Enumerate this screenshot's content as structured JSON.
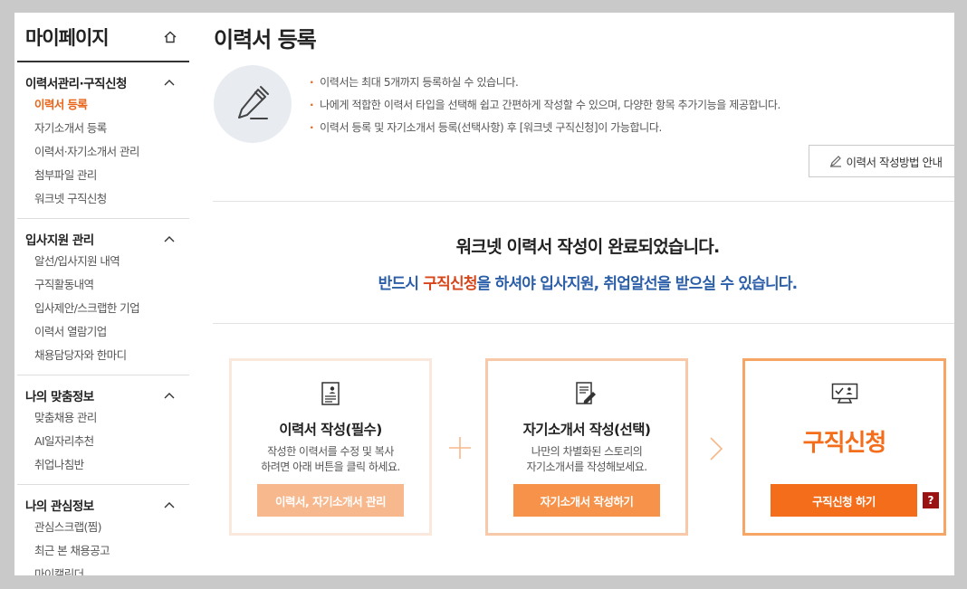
{
  "sidebar": {
    "title": "마이페이지",
    "groups": [
      {
        "label": "이력서관리·구직신청",
        "items": [
          "이력서 등록",
          "자기소개서 등록",
          "이력서·자기소개서 관리",
          "첨부파일 관리",
          "워크넷 구직신청"
        ]
      },
      {
        "label": "입사지원 관리",
        "items": [
          "알선/입사지원 내역",
          "구직활동내역",
          "입사제안/스크랩한 기업",
          "이력서 열람기업",
          "채용담당자와 한마디"
        ]
      },
      {
        "label": "나의 맞춤정보",
        "items": [
          "맞춤채용 관리",
          "AI일자리추천",
          "취업나침반"
        ]
      },
      {
        "label": "나의 관심정보",
        "items": [
          "관심스크랩(찜)",
          "최근 본 채용공고",
          "마이캘린더"
        ]
      }
    ]
  },
  "main": {
    "title": "이력서 등록",
    "notes": [
      "이력서는 최대 5개까지 등록하실 수 있습니다.",
      "나에게 적합한 이력서 타입을 선택해 쉽고 간편하게 작성할 수 있으며, 다양한 항목 추가기능을 제공합니다.",
      "이력서 등록 및 자기소개서 등록(선택사항) 후 [워크넷 구직신청]이 가능합니다."
    ],
    "guide_button": "이력서 작성방법 안내",
    "complete_message": "워크넷 이력서 작성이 완료되었습니다.",
    "notice": {
      "before": "반드시 ",
      "highlight": "구직신청",
      "after": "을 하셔야 입사지원, 취업알선을 받으실 수 있습니다."
    },
    "steps": [
      {
        "title": "이력서 작성(필수)",
        "desc_line1": "작성한 이력서를 수정 및 복사",
        "desc_line2": "하려면 아래 버튼을 클릭 하세요.",
        "button": "이력서, 자기소개서 관리"
      },
      {
        "title": "자기소개서 작성(선택)",
        "desc_line1": "나만의 차별화된 스토리의",
        "desc_line2": "자기소개서를 작성해보세요.",
        "button": "자기소개서 작성하기"
      },
      {
        "title": "구직신청",
        "button": "구직신청 하기",
        "help": "?"
      }
    ]
  },
  "colors": {
    "accent": "#f36d1b",
    "notice_blue": "#2b5ea8",
    "highlight_red": "#d7461b",
    "help_badge": "#9b1212"
  }
}
